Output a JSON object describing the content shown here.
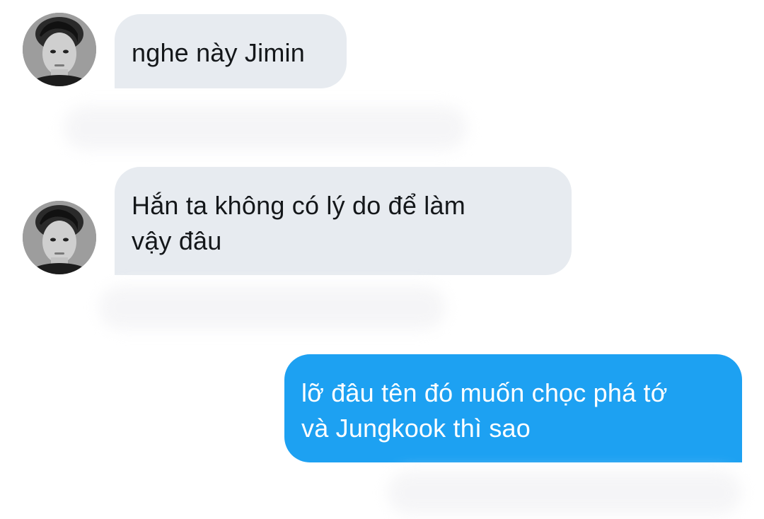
{
  "conversation": {
    "messages": [
      {
        "direction": "incoming",
        "lines": [
          "nghe này Jimin"
        ]
      },
      {
        "direction": "incoming",
        "lines": [
          "Hắn ta không có lý do để làm",
          "vậy đâu"
        ]
      },
      {
        "direction": "outgoing",
        "lines": [
          "lỡ đâu tên đó muốn chọc phá tớ",
          "và Jungkook thì sao"
        ]
      }
    ]
  },
  "colors": {
    "incoming_bubble": "#e7ebf0",
    "incoming_text": "#14171a",
    "outgoing_bubble": "#1da1f2",
    "outgoing_text": "#ffffff",
    "background": "#ffffff"
  },
  "icons": {
    "avatar": "contact-avatar-photo"
  }
}
